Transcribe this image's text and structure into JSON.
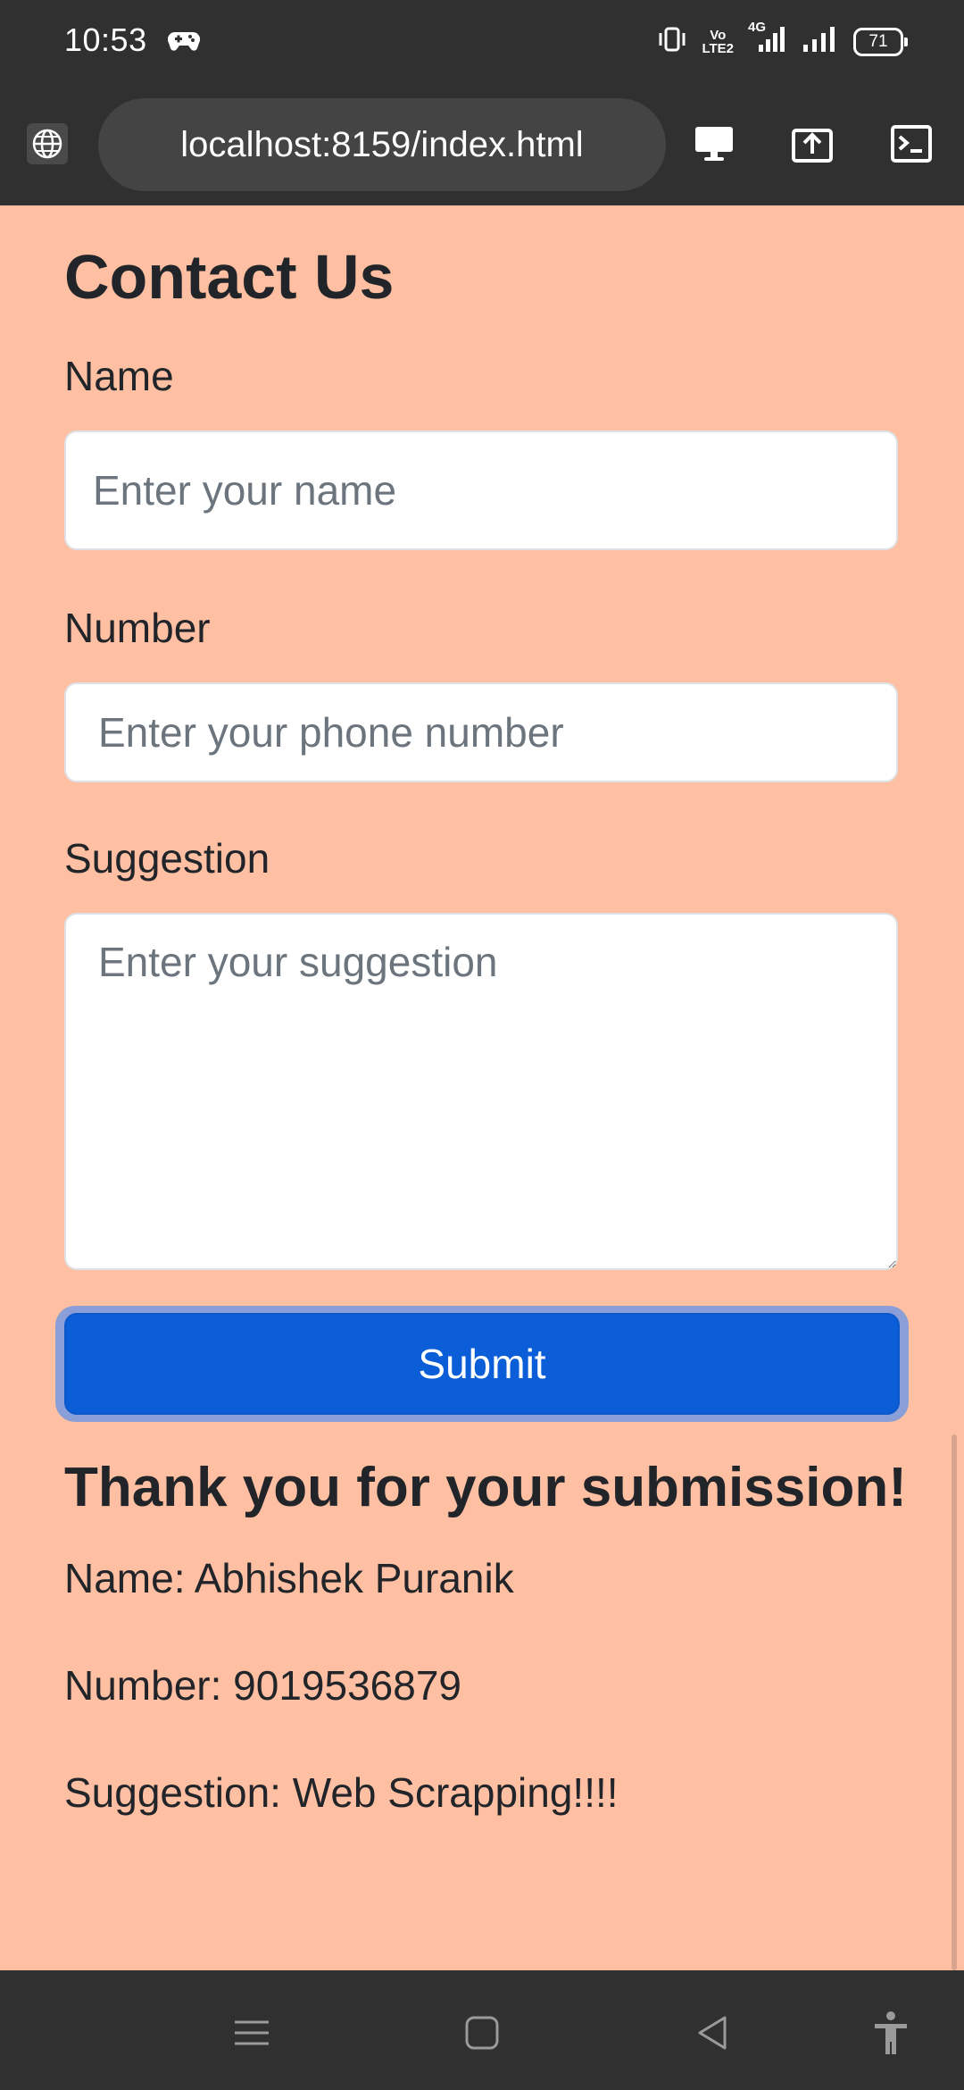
{
  "status_bar": {
    "time": "10:53",
    "network_label_top": "Vo",
    "network_label_bottom": "LTE2",
    "network_type": "4G",
    "battery": "71"
  },
  "browser": {
    "url": "localhost:8159/index.html"
  },
  "form": {
    "title": "Contact Us",
    "name_label": "Name",
    "name_placeholder": "Enter your name",
    "number_label": "Number",
    "number_placeholder": "Enter your phone number",
    "suggestion_label": "Suggestion",
    "suggestion_placeholder": "Enter your suggestion",
    "submit_label": "Submit"
  },
  "result": {
    "title": "Thank you for your submission!",
    "name_line": "Name: Abhishek Puranik",
    "number_line": "Number: 9019536879",
    "suggestion_line": "Suggestion: Web Scrapping!!!!"
  },
  "icons": {
    "gamepad": "gamepad-icon",
    "vibrate": "vibrate-icon",
    "signal": "signal-icon",
    "globe": "globe-icon",
    "desktop": "desktop-icon",
    "share": "share-icon",
    "terminal": "terminal-icon",
    "menu": "menu-icon",
    "home": "home-icon",
    "back": "back-icon",
    "accessibility": "accessibility-icon"
  }
}
